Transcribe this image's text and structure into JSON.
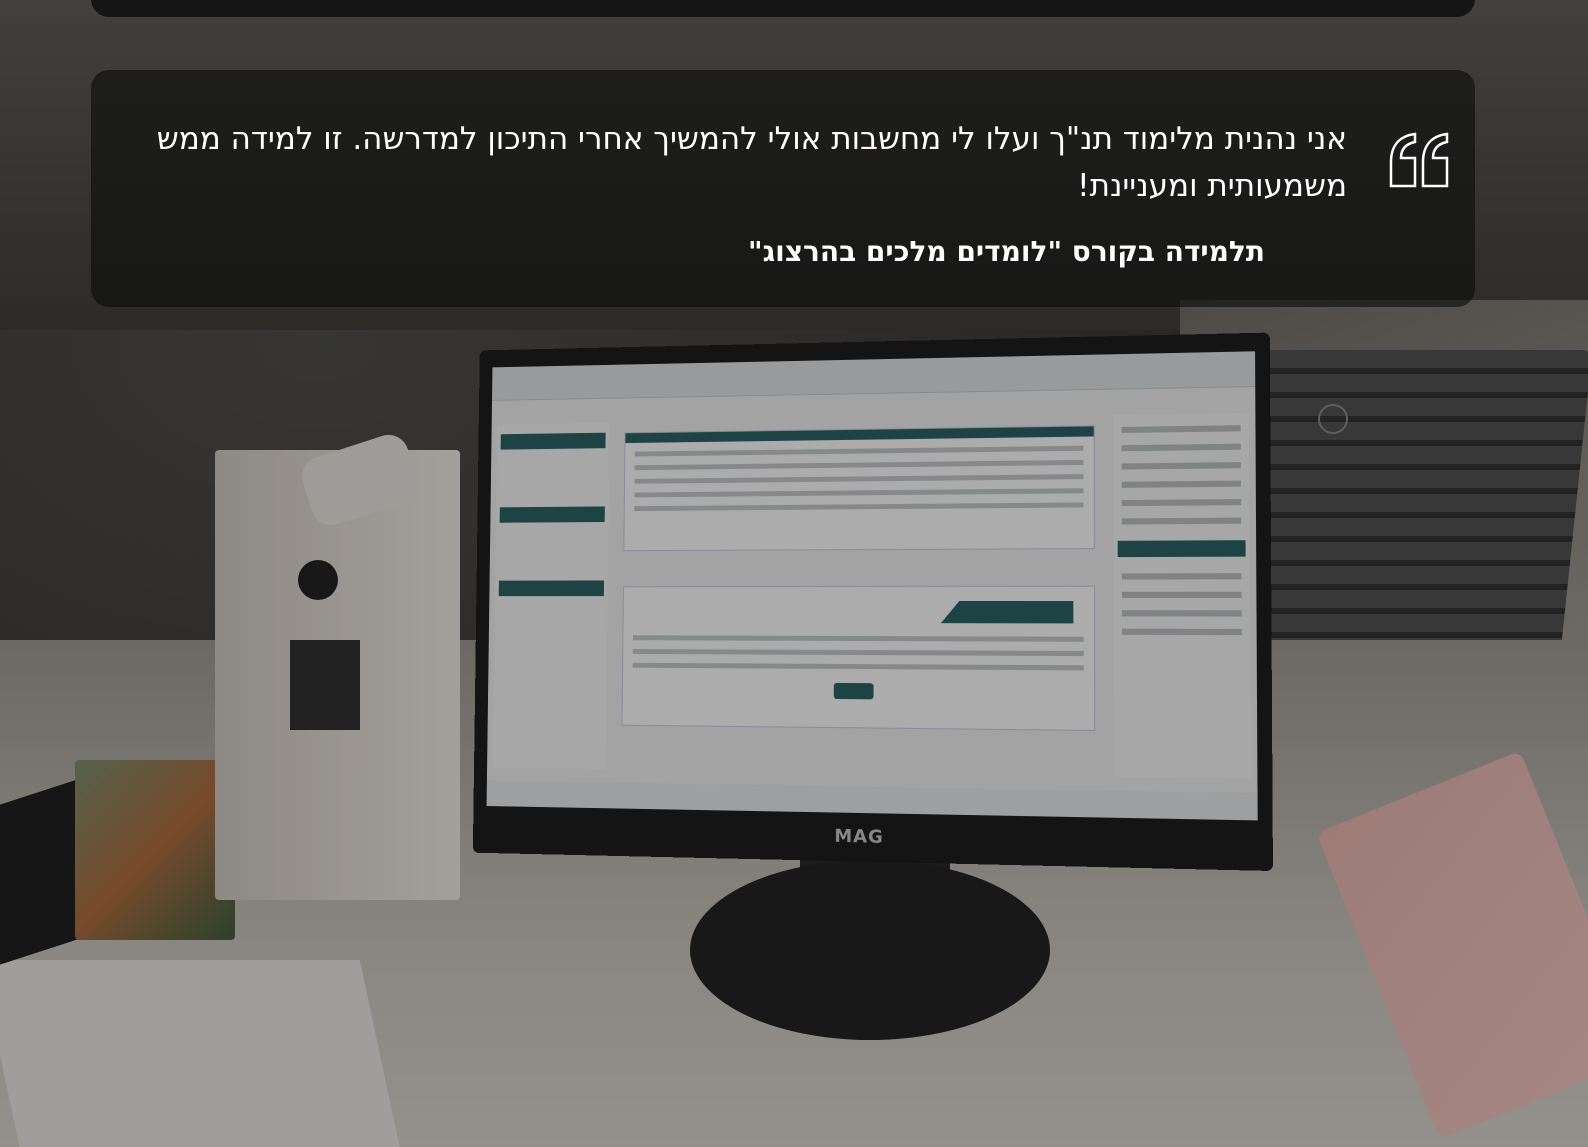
{
  "testimonial": {
    "quote": "אני נהנית מלימוד תנ\"ך ועלו לי מחשבות אולי להמשיך אחרי התיכון למדרשה. זו למידה ממש משמעותית ומעניינת!",
    "author": "תלמידה בקורס \"לומדים מלכים בהרצוג\"",
    "quote_icon": "quote-marks-icon"
  },
  "photo": {
    "monitor_brand": "MAG"
  },
  "colors": {
    "overlay": "#0c0c0c",
    "text": "#ffffff",
    "screen_accent": "#245e60"
  }
}
